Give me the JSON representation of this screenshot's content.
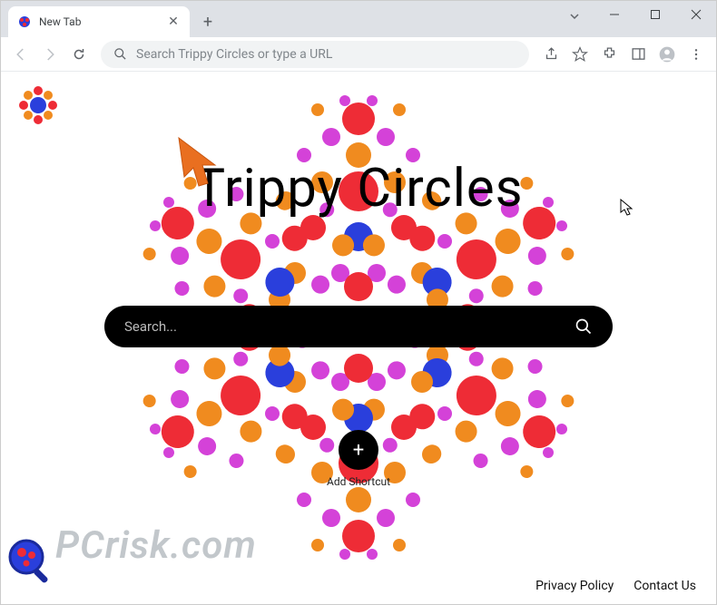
{
  "titlebar": {
    "tab_title": "New Tab"
  },
  "omnibox": {
    "placeholder": "Search Trippy Circles or type a URL"
  },
  "page": {
    "heading": "Trippy Circles",
    "search_placeholder": "Search...",
    "add_shortcut_label": "Add Shortcut"
  },
  "footer": {
    "privacy": "Privacy Policy",
    "contact": "Contact Us"
  },
  "watermark": {
    "text": "PCrisk.com"
  },
  "colors": {
    "red": "#ee2c36",
    "blue": "#2a3fdc",
    "orange": "#f08b1f",
    "magenta": "#d442d8",
    "arrow": "#e96f20"
  }
}
